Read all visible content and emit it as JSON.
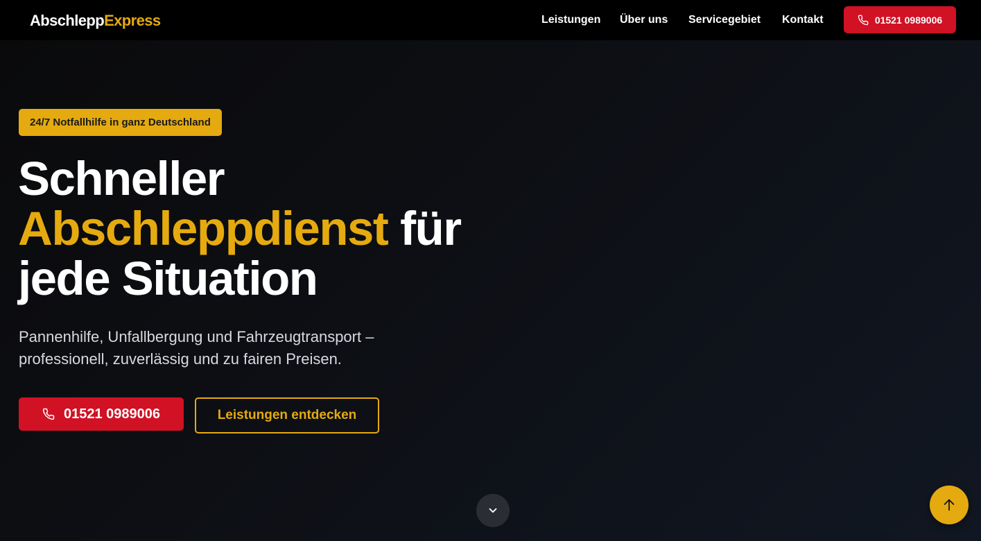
{
  "colors": {
    "accent": "#e5aa0f",
    "cta_red": "#d11124",
    "background": "#0d0f14"
  },
  "header": {
    "logo_part1": "Abschlepp",
    "logo_part2": "Express",
    "nav": {
      "services": "Leistungen",
      "about": "Über uns",
      "area": "Servicegebiet",
      "contact": "Kontakt"
    },
    "phone_label": "01521 0989006",
    "phone_icon": "phone-icon"
  },
  "hero": {
    "badge": "24/7 Notfallhilfe in ganz Deutschland",
    "headline_line1": "Schneller",
    "headline_accent": "Abschleppdienst",
    "headline_mid": "für",
    "headline_line3": "jede Situation",
    "subtitle": "Pannenhilfe, Unfallbergung und Fahrzeugtransport – professionell, zuverlässig und zu fairen Preisen.",
    "primary_cta": "01521 0989006",
    "secondary_cta": "Leistungen entdecken"
  },
  "controls": {
    "scroll_down_icon": "chevron-down-icon",
    "back_to_top_icon": "arrow-up-icon"
  }
}
